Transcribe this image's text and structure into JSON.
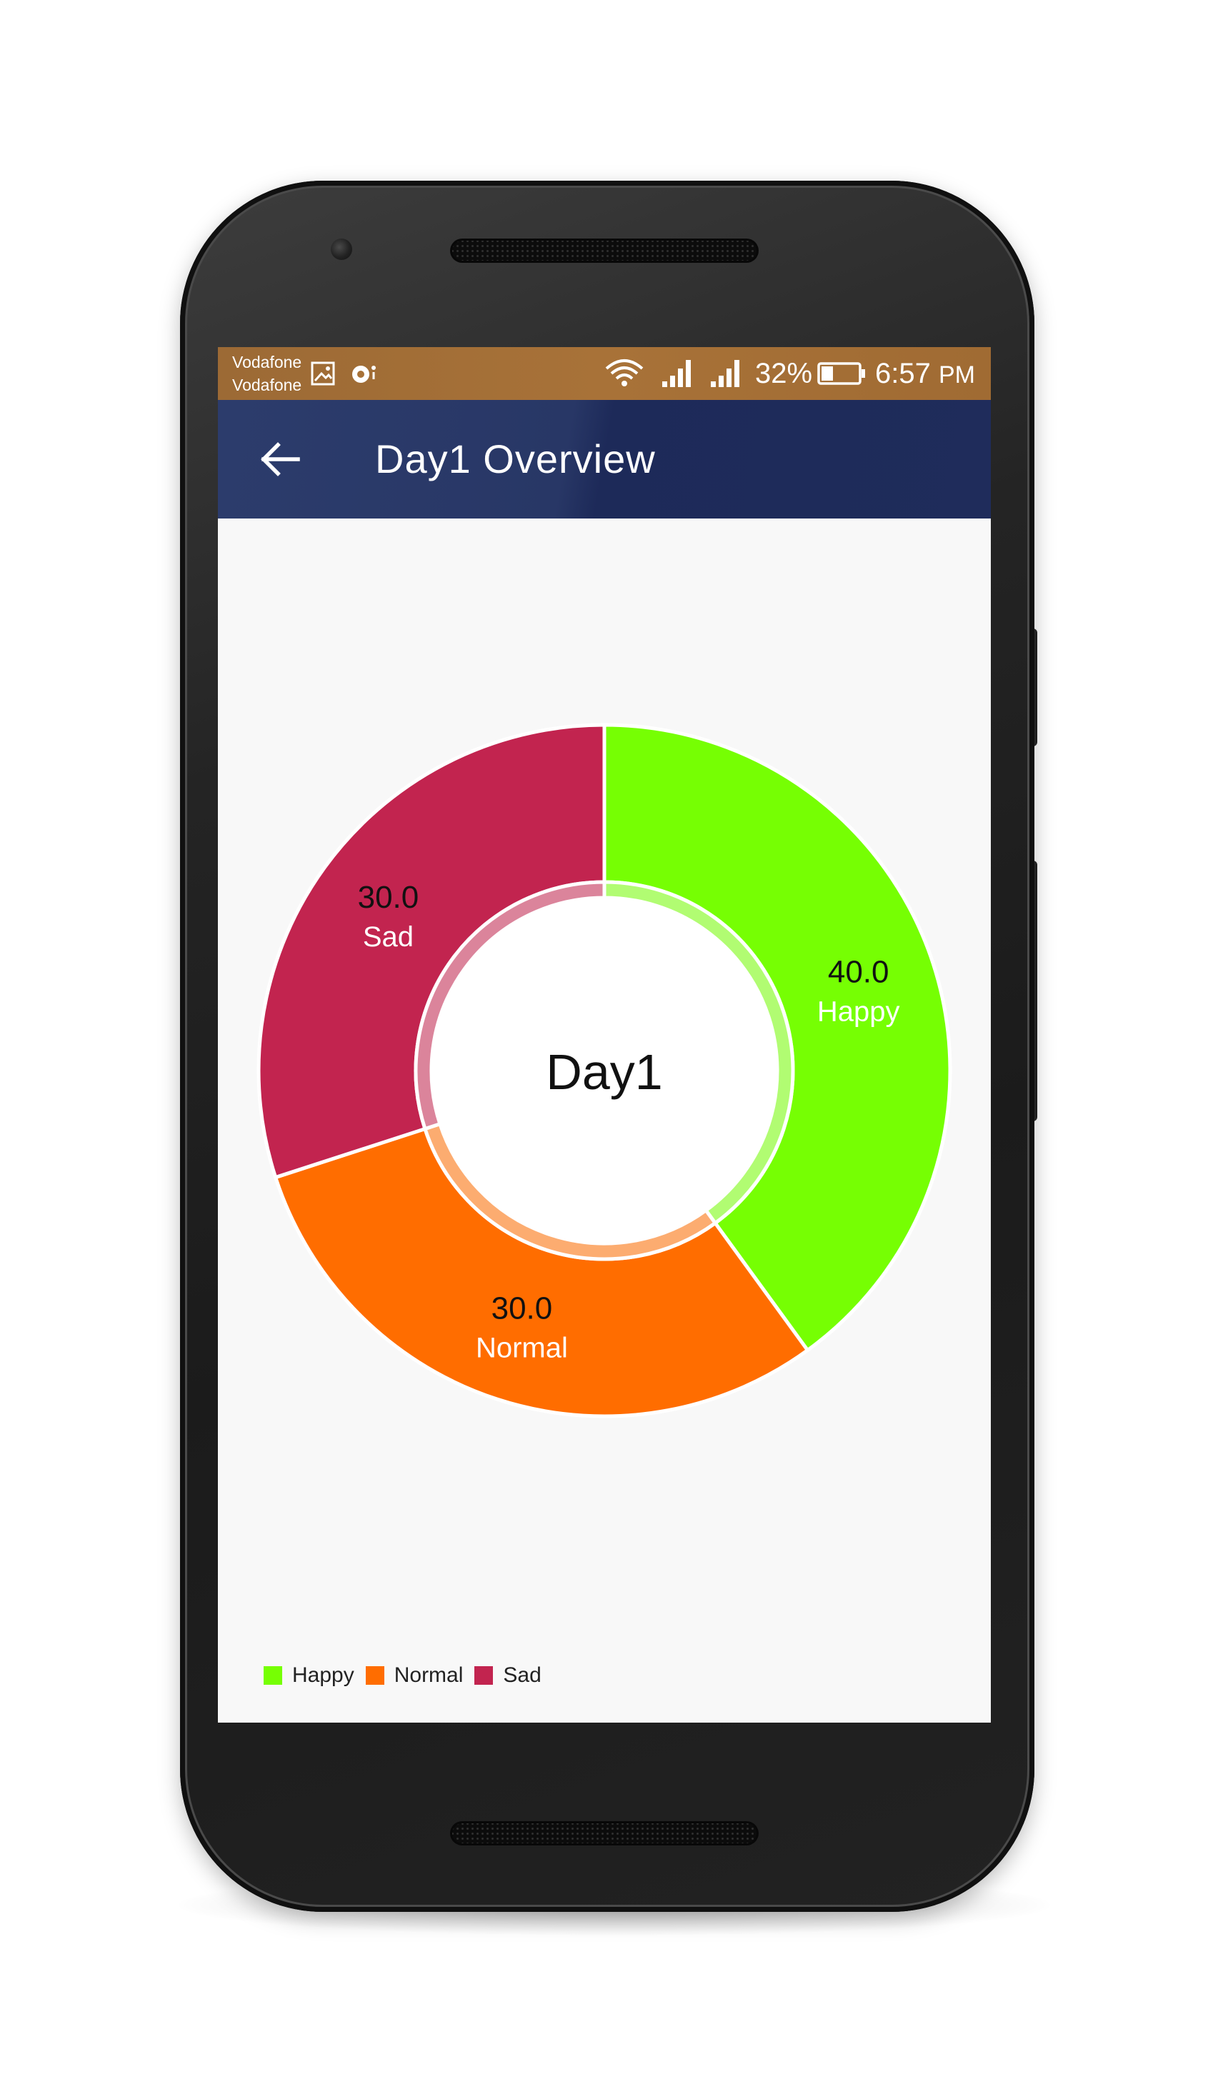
{
  "status_bar": {
    "carrier_1": "Vodafone",
    "carrier_2": "Vodafone",
    "battery_percent": "32%",
    "time": "6:57",
    "ampm": "PM",
    "icons": [
      "gallery-icon",
      "notification-icon",
      "wifi-icon",
      "signal-1-icon",
      "signal-2-icon",
      "battery-icon"
    ]
  },
  "app_bar": {
    "back_icon": "arrow-left-icon",
    "title": "Day1 Overview"
  },
  "chart_data": {
    "type": "pie",
    "style": "donut",
    "center_text": "Day1",
    "categories": [
      "Happy",
      "Normal",
      "Sad"
    ],
    "values": [
      40.0,
      30.0,
      30.0
    ],
    "value_labels": [
      "40.0",
      "30.0",
      "30.0"
    ],
    "colors": [
      "#76ff03",
      "#ff6d00",
      "#c2244f"
    ],
    "legend": {
      "position": "bottom-left",
      "entries": [
        "Happy",
        "Normal",
        "Sad"
      ]
    }
  },
  "colors": {
    "status_bar": "#a87238",
    "app_bar": "#283766",
    "screen_background": "#f8f8f8"
  }
}
